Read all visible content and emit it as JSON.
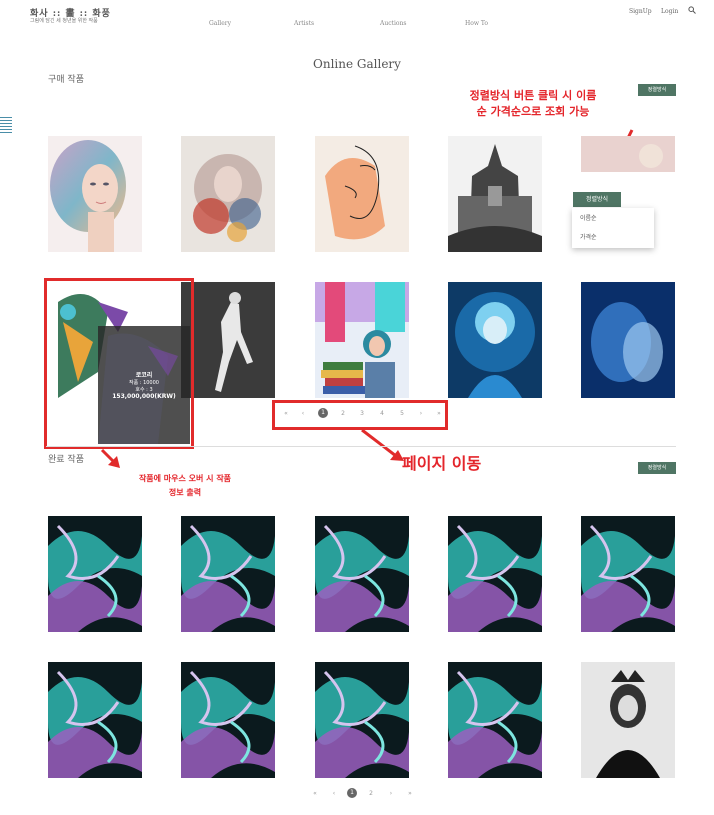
{
  "brand": {
    "title": "화사 :: 畵 :: 화풍",
    "subtitle": "그림에 담긴 세 청년을 위한 작품"
  },
  "nav": [
    "Gallery",
    "Artists",
    "Auctions",
    "How To"
  ],
  "utility": {
    "signup": "SignUp",
    "login": "Login"
  },
  "page_title": "Online Gallery",
  "section_purchase": "구매 작품",
  "section_completed": "완료 작품",
  "sort_button": "정렬방식",
  "dropdown": {
    "header": "정렬방식",
    "options": [
      "이름순",
      "가격순"
    ]
  },
  "annotations": {
    "sort_line1": "정렬방식 버튼 클릭 시 이름",
    "sort_line2": "순 가격순으로 조회 가능",
    "page_move": "페이지 이동",
    "hover_line1": "작품에 마우스 오버 시 작품",
    "hover_line2": "정보 출력"
  },
  "hover_info": {
    "name": "로코리",
    "line1": "작품 : 10000",
    "line2": "호수 : 3",
    "price": "153,000,000(KRW)"
  },
  "pagination_top": [
    "«",
    "‹",
    "1",
    "2",
    "3",
    "4",
    "5",
    "›",
    "»"
  ],
  "pagination_bottom": [
    "«",
    "‹",
    "1",
    "2",
    "›",
    "»"
  ],
  "icons": [
    "search-icon",
    "menu-icon",
    "arrow-icon"
  ]
}
